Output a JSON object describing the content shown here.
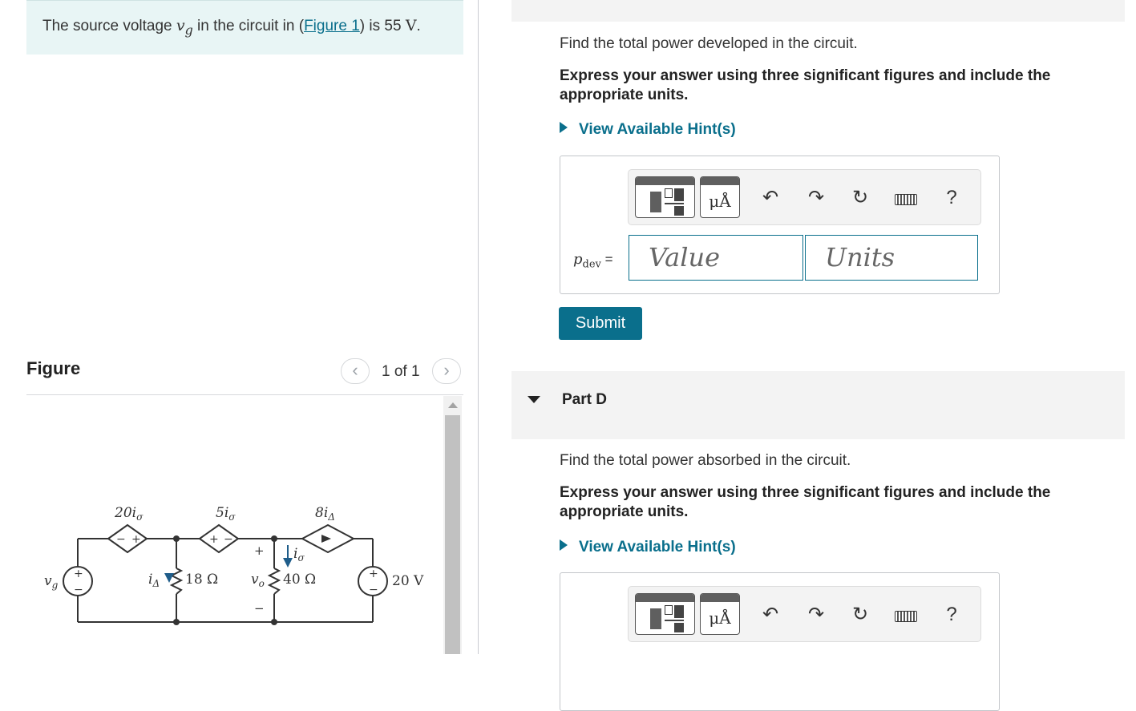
{
  "problem": {
    "prefix": "The source voltage ",
    "var_symbol": "v",
    "var_sub": "g",
    "middle": " in the circuit in (",
    "figure_link": "Figure 1",
    "suffix": ") is 55 ",
    "unit": "V",
    "end": "."
  },
  "figure": {
    "title": "Figure",
    "page_indicator": "1 of 1",
    "prev_icon": "chevron-left-icon",
    "next_icon": "chevron-right-icon",
    "labels": {
      "src_left": "v",
      "src_left_sub": "g",
      "dep1": "20i",
      "dep1_sub": "σ",
      "dep2": "5i",
      "dep2_sub": "σ",
      "dep3": "8i",
      "dep3_sub": "Δ",
      "i_delta": "i",
      "i_delta_sub": "Δ",
      "r1": "18 Ω",
      "vo": "v",
      "vo_sub": "o",
      "r2": "40 Ω",
      "i_sigma": "i",
      "i_sigma_sub": "σ",
      "src_right": "20 V",
      "plus": "+",
      "minus": "−"
    }
  },
  "part_c": {
    "question": "Find the total power developed in the circuit.",
    "instruction": "Express your answer using three significant figures and include the appropriate units.",
    "hint": "View Available Hint(s)",
    "eq_var": "p",
    "eq_sub": "dev",
    "eq_sign": " =",
    "value_placeholder": "Value",
    "units_placeholder": "Units",
    "units_tool_text": "μÅ",
    "help": "?",
    "submit": "Submit"
  },
  "part_d": {
    "title": "Part D",
    "question": "Find the total power absorbed in the circuit.",
    "instruction": "Express your answer using three significant figures and include the appropriate units.",
    "hint": "View Available Hint(s)",
    "units_tool_text": "μÅ",
    "help": "?"
  },
  "toolbar_icons": [
    "templates-icon",
    "units-icon",
    "undo-icon",
    "redo-icon",
    "reset-icon",
    "keyboard-icon",
    "help-icon"
  ],
  "colors": {
    "accent": "#0a6f8c",
    "problem_bg": "#e8f5f5",
    "part_bg": "#f3f3f3"
  }
}
